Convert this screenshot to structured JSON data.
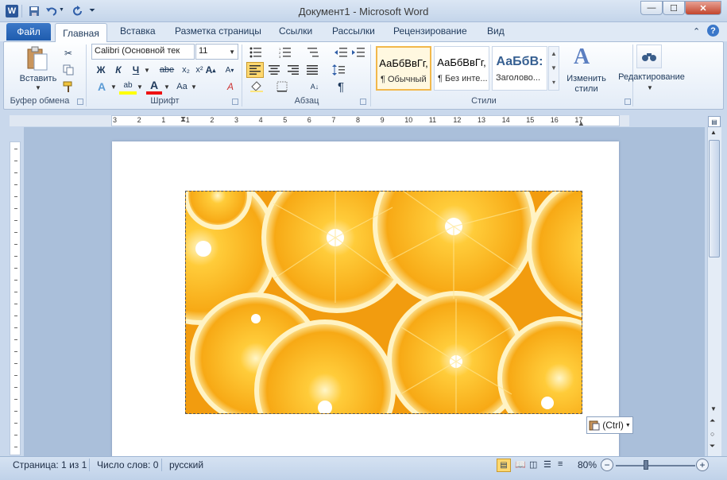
{
  "window": {
    "title": "Документ1 - Microsoft Word",
    "min_glyph": "—",
    "max_glyph": "☐",
    "close_glyph": "✕"
  },
  "qat": {
    "logo": "W"
  },
  "tabs": [
    "Файл",
    "Главная",
    "Вставка",
    "Разметка страницы",
    "Ссылки",
    "Рассылки",
    "Рецензирование",
    "Вид"
  ],
  "ribbon": {
    "clipboard": {
      "paste_label": "Вставить",
      "group": "Буфер обмена"
    },
    "font": {
      "font_name": "Calibri (Основной тек",
      "font_size": "11",
      "group": "Шрифт",
      "bold": "Ж",
      "italic": "К",
      "underline": "Ч",
      "strike": "abe",
      "sub": "x₂",
      "sup": "x²",
      "case": "Aa",
      "grow": "A",
      "shrink": "A",
      "clear": "A"
    },
    "paragraph": {
      "group": "Абзац",
      "pilcrow": "¶"
    },
    "styles": {
      "group": "Стили",
      "items": [
        {
          "sample": "АаБбВвГг,",
          "name": "¶ Обычный"
        },
        {
          "sample": "АаБбВвГг,",
          "name": "¶ Без инте..."
        },
        {
          "sample": "АаБбВ:",
          "name": "Заголово..."
        }
      ],
      "change_label": "Изменить стили"
    },
    "editing": {
      "label": "Редактирование"
    }
  },
  "ruler": {
    "numbers": [
      "3",
      "2",
      "1",
      "1",
      "2",
      "3",
      "4",
      "5",
      "6",
      "7",
      "8",
      "9",
      "10",
      "11",
      "12",
      "13",
      "14",
      "15",
      "16",
      "17"
    ]
  },
  "paste_options": {
    "label": "(Ctrl)"
  },
  "status": {
    "page": "Страница: 1 из 1",
    "words": "Число слов: 0",
    "lang": "русский",
    "zoom": "80%"
  },
  "colors": {
    "accent": "#2b579a",
    "orange": "#f7a915",
    "file_tab": "#1f5cae"
  }
}
